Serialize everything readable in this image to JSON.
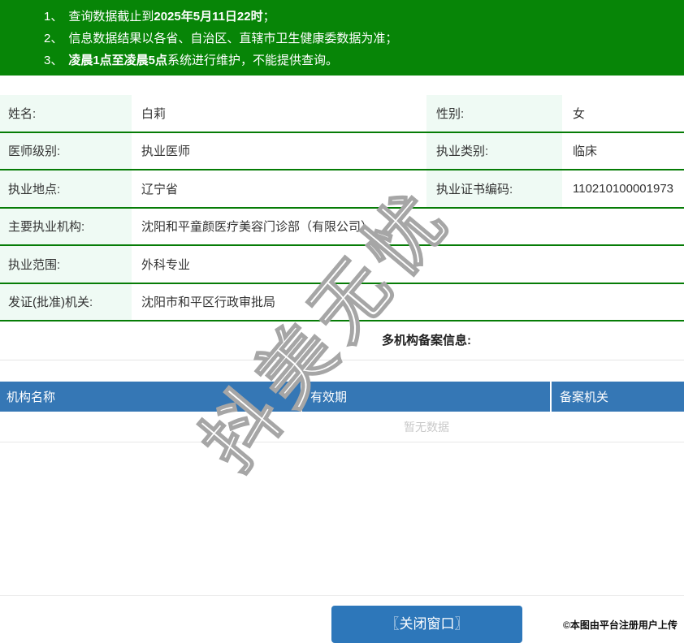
{
  "notice": {
    "lines": [
      {
        "num": "1、",
        "pre": "查询数据截止到",
        "bold": "2025年5月11日22时",
        "post": "；"
      },
      {
        "num": "2、",
        "pre": "信息数据结果以各省、自治区、直辖市卫生健康委数据为准；",
        "bold": "",
        "post": ""
      },
      {
        "num": "3、",
        "pre": "",
        "bold": "凌晨1点至凌晨5点",
        "post": "系统进行维护，不能提供查询。"
      }
    ]
  },
  "doctor": {
    "name_label": "姓名:",
    "name_value": "白莉",
    "gender_label": "性别:",
    "gender_value": "女",
    "level_label": "医师级别:",
    "level_value": "执业医师",
    "category_label": "执业类别:",
    "category_value": "临床",
    "location_label": "执业地点:",
    "location_value": "辽宁省",
    "cert_label": "执业证书编码:",
    "cert_value": "110210100001973",
    "org_label": "主要执业机构:",
    "org_value": "沈阳和平童颜医疗美容门诊部（有限公司）",
    "scope_label": "执业范围:",
    "scope_value": "外科专业",
    "issuer_label": "发证(批准)机关:",
    "issuer_value": "沈阳市和平区行政审批局"
  },
  "multi_org": {
    "title": "多机构备案信息:",
    "columns": [
      "机构名称",
      "有效期",
      "备案机关"
    ],
    "empty_text": "暂无数据"
  },
  "watermark": {
    "text": "抖美无忧"
  },
  "footer": {
    "close_button": "〖关闭窗口〗",
    "copyright": "©本图由平台注册用户上传"
  },
  "colors": {
    "banner_green": "#078507",
    "label_bg": "#effaf4",
    "row_border_green": "#067c06",
    "header_blue": "#3577b5",
    "button_blue": "#2d77ba"
  }
}
